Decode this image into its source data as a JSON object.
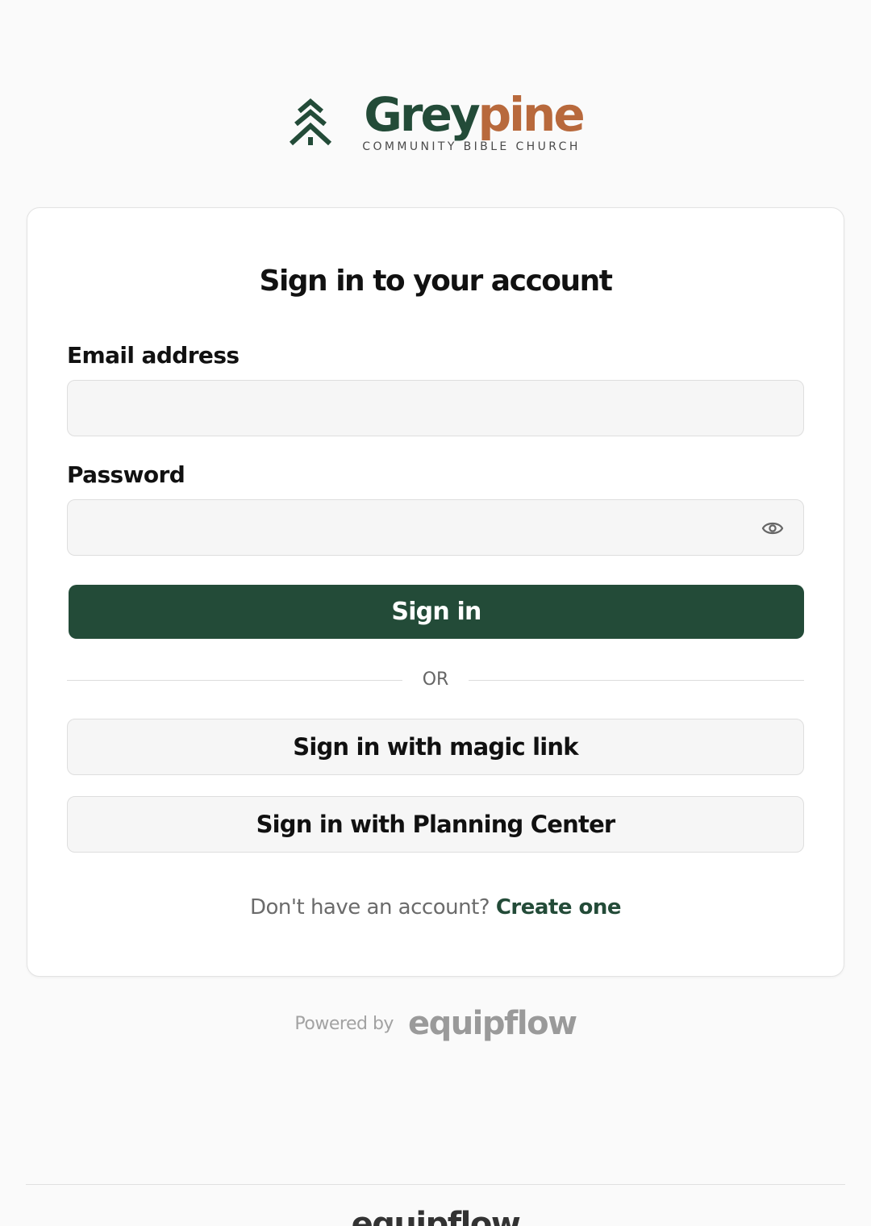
{
  "brand": {
    "name_part1": "Grey",
    "name_part2": "pine",
    "subtitle": "COMMUNITY BIBLE CHURCH",
    "icon": "pine-tree-icon",
    "colors": {
      "primary": "#234b38",
      "accent": "#b8693c"
    }
  },
  "form": {
    "title": "Sign in to your account",
    "email": {
      "label": "Email address",
      "value": "",
      "placeholder": ""
    },
    "password": {
      "label": "Password",
      "value": "",
      "placeholder": "",
      "toggle_icon": "eye-icon"
    },
    "submit_label": "Sign in",
    "divider_text": "OR",
    "magic_link_label": "Sign in with magic link",
    "planning_center_label": "Sign in with Planning Center",
    "signup_prompt": "Don't have an account?",
    "signup_link": "Create one"
  },
  "powered": {
    "label": "Powered by",
    "logo": "equipflow"
  },
  "footer": {
    "logo": "equipflow"
  }
}
